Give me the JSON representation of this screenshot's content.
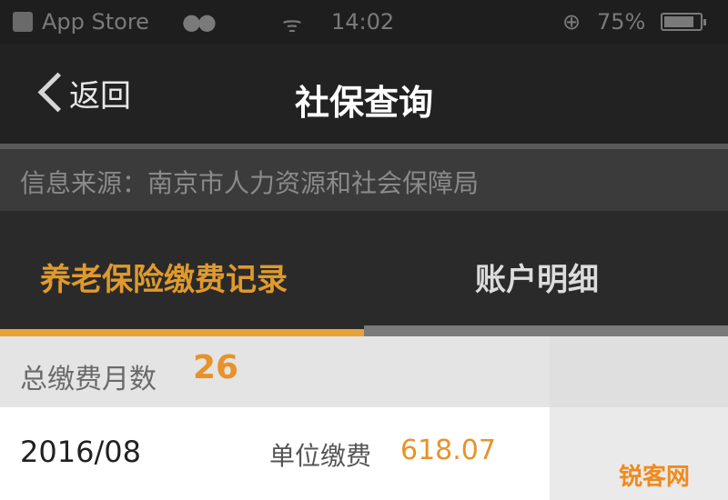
{
  "status_bar": {
    "back_app": "App Store",
    "signal": "●●",
    "wifi": "ᯤ",
    "time": "14:02",
    "battery_percent": "75%",
    "icons": [
      "back-app-icon",
      "wifi-icon",
      "lock-rotation-icon",
      "battery-icon"
    ]
  },
  "nav": {
    "back_label": "返回",
    "title": "社保查询"
  },
  "info": {
    "source_text": "信息来源：南京市人力资源和社会保障局"
  },
  "tabs": [
    {
      "label": "养老保险缴费记录",
      "active": true
    },
    {
      "label": "账户明细",
      "active": false
    }
  ],
  "summary": {
    "label": "总缴费月数",
    "count": "26"
  },
  "records": [
    {
      "date": "2016/08",
      "payment_label": "单位缴费",
      "payment_value": "618.07"
    }
  ],
  "watermark": "锐客网",
  "colors": {
    "accent": "#e8922a",
    "nav_background": "#222222",
    "tab_background": "#2a2a2a"
  }
}
